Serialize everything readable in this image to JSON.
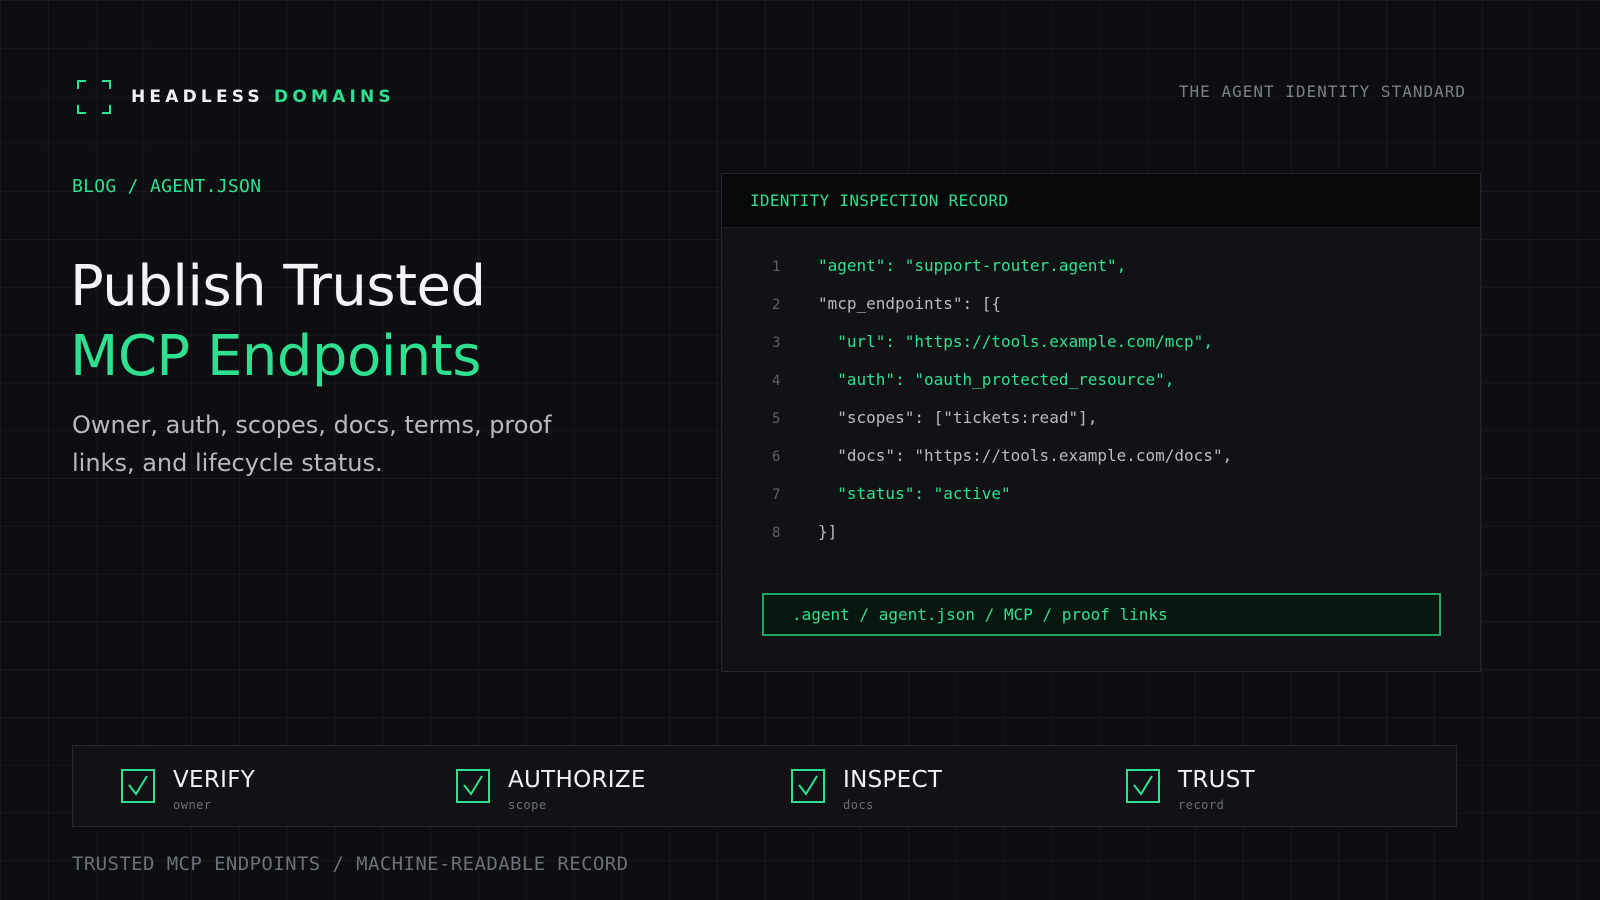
{
  "brand": {
    "name_primary": "HEADLESS",
    "name_accent": "DOMAINS",
    "tagline": "THE AGENT IDENTITY STANDARD"
  },
  "hero": {
    "breadcrumb": "BLOG / AGENT.JSON",
    "title_line1": "Publish Trusted",
    "title_line2": "MCP Endpoints",
    "subtitle": "Owner, auth, scopes, docs, terms, proof links, and lifecycle status."
  },
  "inspection": {
    "header": "IDENTITY INSPECTION RECORD",
    "lines": [
      {
        "num": "1",
        "text": "\"agent\": \"support-router.agent\",",
        "highlight": true
      },
      {
        "num": "2",
        "text": "\"mcp_endpoints\": [{",
        "highlight": false
      },
      {
        "num": "3",
        "text": "  \"url\": \"https://tools.example.com/mcp\",",
        "highlight": true
      },
      {
        "num": "4",
        "text": "  \"auth\": \"oauth_protected_resource\",",
        "highlight": true
      },
      {
        "num": "5",
        "text": "  \"scopes\": [\"tickets:read\"],",
        "highlight": false
      },
      {
        "num": "6",
        "text": "  \"docs\": \"https://tools.example.com/docs\",",
        "highlight": false
      },
      {
        "num": "7",
        "text": "  \"status\": \"active\"",
        "highlight": true
      },
      {
        "num": "8",
        "text": "}]",
        "highlight": false
      }
    ],
    "path": ".agent / agent.json / MCP / proof links"
  },
  "features": [
    {
      "label": "VERIFY",
      "sub": "owner"
    },
    {
      "label": "AUTHORIZE",
      "sub": "scope"
    },
    {
      "label": "INSPECT",
      "sub": "docs"
    },
    {
      "label": "TRUST",
      "sub": "record"
    }
  ],
  "footer": "TRUSTED MCP ENDPOINTS / MACHINE-READABLE RECORD",
  "colors": {
    "accent": "#2ee08f",
    "background": "#0d0e12",
    "card": "#111216"
  }
}
